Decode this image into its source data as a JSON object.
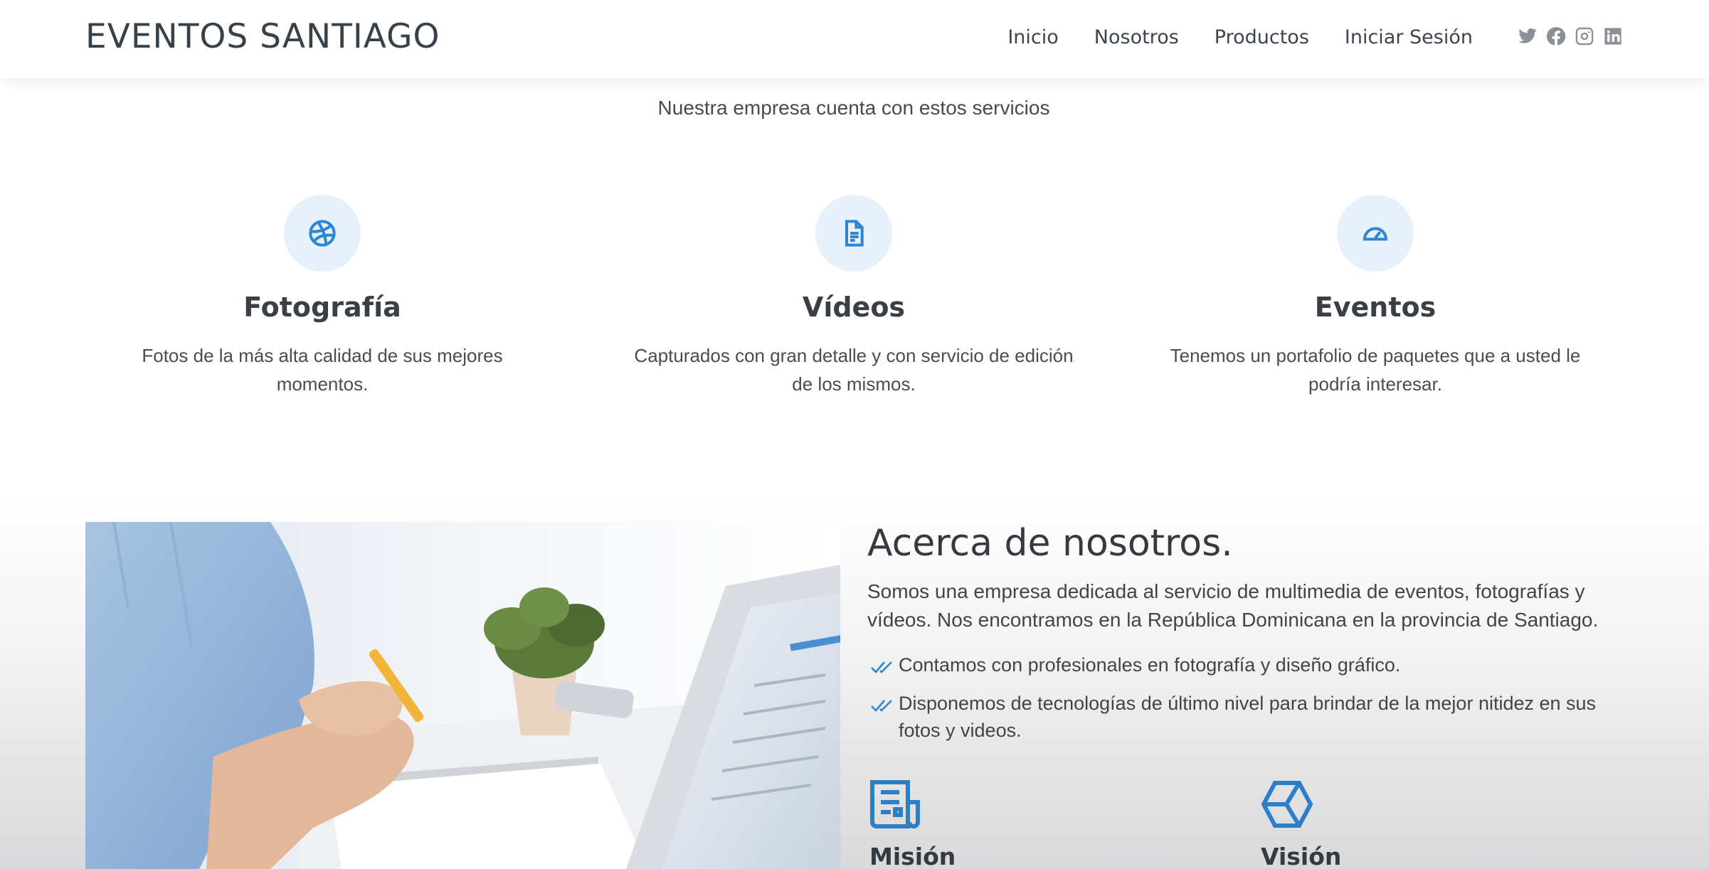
{
  "header": {
    "brand": "EVENTOS SANTIAGO",
    "nav": [
      "Inicio",
      "Nosotros",
      "Productos",
      "Iniciar Sesión"
    ],
    "social_icons": [
      "twitter-icon",
      "facebook-icon",
      "instagram-icon",
      "linkedin-icon"
    ]
  },
  "services": {
    "subtitle": "Nuestra empresa cuenta con estos servicios",
    "items": [
      {
        "icon": "dribbble-icon",
        "title": "Fotografía",
        "text": "Fotos de la más alta calidad de sus mejores momentos."
      },
      {
        "icon": "document-icon",
        "title": "Vídeos",
        "text": "Capturados con gran detalle y con servicio de edición de los mismos."
      },
      {
        "icon": "speedometer-icon",
        "title": "Eventos",
        "text": "Tenemos un portafolio de paquetes que a usted le podría interesar."
      }
    ]
  },
  "about": {
    "title": "Acerca de nosotros.",
    "description": "Somos una empresa dedicada al servicio de multimedia de eventos, fotografías y vídeos. Nos encontramos en la República Dominicana en la provincia de Santiago.",
    "checks": [
      "Contamos con profesionales en fotografía y diseño gráfico.",
      "Disponemos de tecnologías de último nivel para brindar de la mejor nitidez en sus fotos y videos."
    ],
    "mission": {
      "icon": "newspaper-icon",
      "title": "Misión"
    },
    "vision": {
      "icon": "box-icon",
      "title": "Visión"
    }
  },
  "colors": {
    "accent": "#2d86d3",
    "icon_circle": "#e6f1fc",
    "heading": "#3a3f46"
  }
}
